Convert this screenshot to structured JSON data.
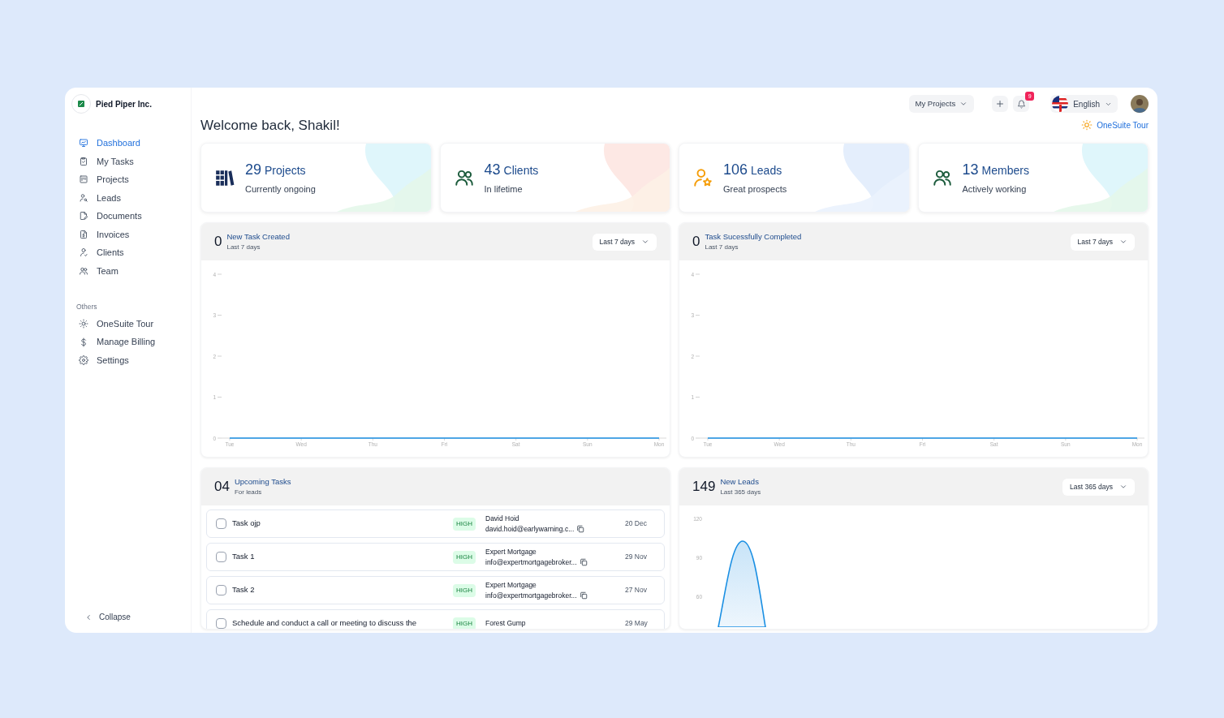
{
  "company": {
    "name": "Pied Piper Inc."
  },
  "nav": [
    {
      "label": "Dashboard",
      "selected": true
    },
    {
      "label": "My Tasks",
      "selected": false
    },
    {
      "label": "Projects",
      "selected": false
    },
    {
      "label": "Leads",
      "selected": false
    },
    {
      "label": "Documents",
      "selected": false
    },
    {
      "label": "Invoices",
      "selected": false
    },
    {
      "label": "Clients",
      "selected": false
    },
    {
      "label": "Team",
      "selected": false
    }
  ],
  "others_heading": "Others",
  "others": [
    {
      "label": "OneSuite Tour",
      "selected": false
    },
    {
      "label": "Manage Billing",
      "selected": false
    },
    {
      "label": "Settings",
      "selected": false
    }
  ],
  "collapse": "Collapse",
  "topbar": {
    "project_menu": "My Projects",
    "notifications": "9",
    "language": "English"
  },
  "welcome": "Welcome back, Shakil!",
  "tour_link": "OneSuite Tour",
  "stats": [
    {
      "value": "29",
      "label": "Projects",
      "caption": "Currently ongoing"
    },
    {
      "value": "43",
      "label": "Clients",
      "caption": "In lifetime"
    },
    {
      "value": "106",
      "label": "Leads",
      "caption": "Great prospects"
    },
    {
      "value": "13",
      "label": "Members",
      "caption": "Actively working"
    }
  ],
  "activity_charts": [
    {
      "count": "0",
      "title": "New Task Created",
      "subtitle": "Last 7 days",
      "range": "Last 7 days",
      "chart_data": {
        "type": "line",
        "categories": [
          "Tue",
          "Wed",
          "Thu",
          "Fri",
          "Sat",
          "Sun",
          "Mon"
        ],
        "series": [
          {
            "color": "#1a8fe3",
            "values": [
              0,
              0,
              0,
              0,
              0,
              0,
              0
            ]
          }
        ],
        "ylim": [
          0,
          4
        ],
        "yticks": [
          0,
          1,
          2,
          3,
          4
        ]
      }
    },
    {
      "count": "0",
      "title": "Task Sucessfully Completed",
      "subtitle": "Last 7 days",
      "range": "Last 7 days",
      "chart_data": {
        "type": "line",
        "categories": [
          "Tue",
          "Wed",
          "Thu",
          "Fri",
          "Sat",
          "Sun",
          "Mon"
        ],
        "series": [
          {
            "color": "#1a8fe3",
            "values": [
              0,
              0,
              0,
              0,
              0,
              0,
              0
            ]
          }
        ],
        "ylim": [
          0,
          4
        ],
        "yticks": [
          0,
          1,
          2,
          3,
          4
        ]
      }
    }
  ],
  "upcoming_tasks": {
    "count": "04",
    "title": "Upcoming Tasks",
    "subtitle": "For leads",
    "tasks": [
      {
        "title": "Task ojp",
        "checked": false,
        "priority": "HIGH",
        "contact": "David Hoid",
        "email": "david.hoid@earlywarning.c...",
        "date": "20 Dec"
      },
      {
        "title": "Task 1",
        "checked": false,
        "priority": "HIGH",
        "contact": "Expert Mortgage",
        "email": "info@expertmortgagebroker...",
        "date": "29 Nov"
      },
      {
        "title": "Task 2",
        "checked": false,
        "priority": "HIGH",
        "contact": "Expert Mortgage",
        "email": "info@expertmortgagebroker...",
        "date": "27 Nov"
      },
      {
        "title": "Schedule and conduct a call or meeting to discuss the",
        "checked": false,
        "priority": "HIGH",
        "contact": "Forest Gump",
        "date": "29 May"
      }
    ]
  },
  "new_leads": {
    "count": "149",
    "title": "New Leads",
    "subtitle": "Last 365 days",
    "range": "Last 365 days",
    "y_ticks": [
      "120",
      "90",
      "60"
    ]
  }
}
